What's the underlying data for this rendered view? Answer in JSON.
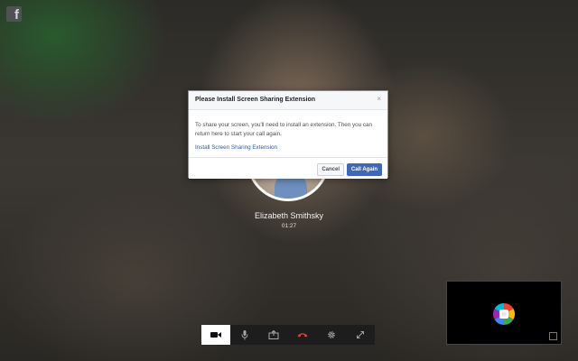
{
  "app": {
    "logo_glyph": "f"
  },
  "call": {
    "caller_name": "Elizabeth Smithsky",
    "duration": "01:27"
  },
  "dialog": {
    "title": "Please Install Screen Sharing Extension",
    "close_glyph": "×",
    "body": "To share your screen, you'll need to install an extension. Then you can return here to start your call again.",
    "link_text": "Install Screen Sharing Extension",
    "cancel_label": "Cancel",
    "call_again_label": "Call Again"
  },
  "toolbar": {
    "buttons": [
      {
        "icon": "video-camera-icon",
        "active": true
      },
      {
        "icon": "microphone-icon",
        "active": false
      },
      {
        "icon": "share-screen-icon",
        "active": false
      },
      {
        "icon": "hang-up-icon",
        "active": false
      },
      {
        "icon": "gear-icon",
        "active": false
      },
      {
        "icon": "fullscreen-icon",
        "active": false
      }
    ]
  },
  "colors": {
    "link": "#365899",
    "primary_button": "#4267b2",
    "hang_up": "#e0433a"
  }
}
